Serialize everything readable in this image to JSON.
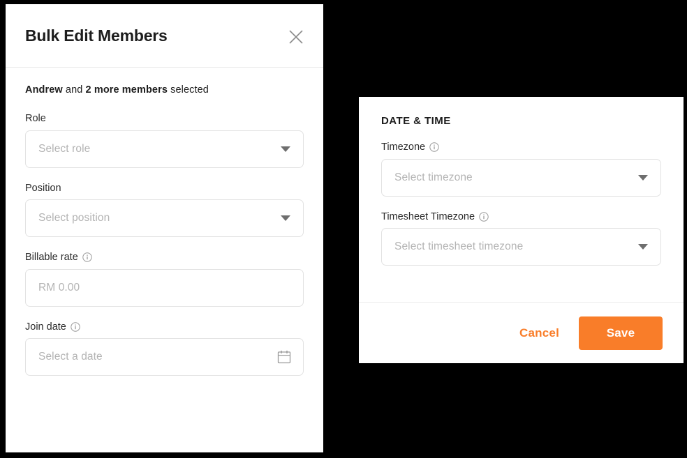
{
  "theme": {
    "accent": "#f97d29",
    "text": "#1d1d1d",
    "placeholder": "#b3b3b3",
    "border": "#e2e2e2",
    "divider": "#eaeaea",
    "backdrop": "#000000"
  },
  "bulk_edit_modal": {
    "title": "Bulk Edit Members",
    "close_icon": "close-icon",
    "selection": {
      "member_name": "Andrew",
      "conjunction": " and ",
      "more_members": "2 more members",
      "suffix": " selected"
    },
    "fields": [
      {
        "label": "Role",
        "placeholder": "Select role",
        "type": "select",
        "has_info": false,
        "icon": "chevron-down-icon"
      },
      {
        "label": "Position",
        "placeholder": "Select position",
        "type": "select",
        "has_info": false,
        "icon": "chevron-down-icon"
      },
      {
        "label": "Billable rate",
        "placeholder": "RM 0.00",
        "type": "text",
        "has_info": true,
        "icon": "none"
      },
      {
        "label": "Join date",
        "placeholder": "Select a date",
        "type": "date",
        "has_info": true,
        "icon": "calendar-icon"
      }
    ]
  },
  "date_time_panel": {
    "section_title": "DATE & TIME",
    "fields": [
      {
        "label": "Timezone",
        "placeholder": "Select timezone",
        "type": "select",
        "has_info": true,
        "icon": "chevron-down-icon"
      },
      {
        "label": "Timesheet Timezone",
        "placeholder": "Select timesheet timezone",
        "type": "select",
        "has_info": true,
        "icon": "chevron-down-icon"
      }
    ],
    "footer": {
      "cancel_label": "Cancel",
      "save_label": "Save"
    }
  }
}
